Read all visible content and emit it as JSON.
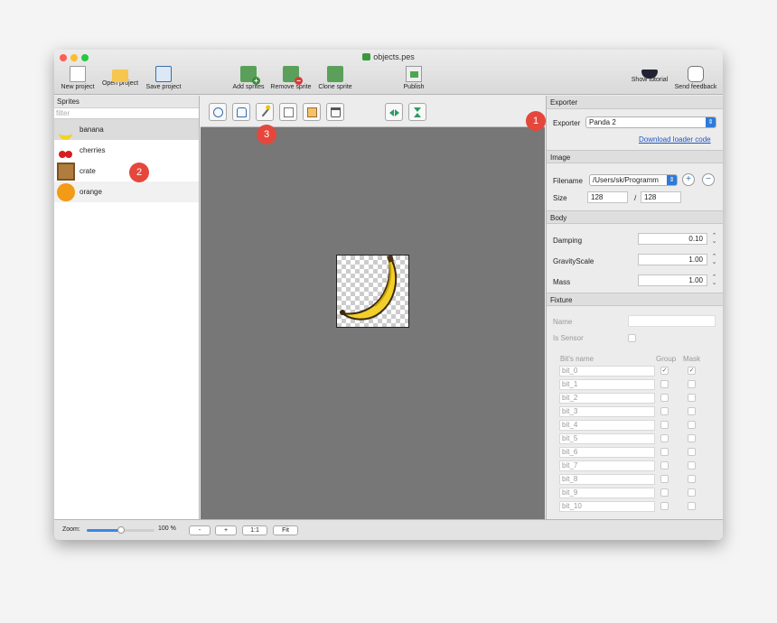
{
  "window": {
    "title": "objects.pes"
  },
  "toolbar": {
    "new_project": "New project",
    "open_project": "Open project",
    "save_project": "Save project",
    "add_sprites": "Add sprites",
    "remove_sprite": "Remove sprite",
    "clone_sprite": "Clone sprite",
    "publish": "Publish",
    "show_tutorial": "Show tutorial",
    "send_feedback": "Send feedback"
  },
  "sprites_panel": {
    "title": "Sprites",
    "filter_placeholder": "filter",
    "items": [
      {
        "name": "banana",
        "selected": true
      },
      {
        "name": "cherries",
        "selected": false
      },
      {
        "name": "crate",
        "selected": false
      },
      {
        "name": "orange",
        "selected": false
      }
    ]
  },
  "editor_tools": [
    "circle-tool",
    "polygon-tool",
    "magic-wand-tool",
    "copy-tool",
    "paste-tool",
    "delete-tool",
    "flip-horizontal-tool",
    "flip-vertical-tool"
  ],
  "exporter": {
    "section": "Exporter",
    "label": "Exporter",
    "value": "Panda 2",
    "download_link": "Download loader code"
  },
  "image": {
    "section": "Image",
    "filename_label": "Filename",
    "filename_value": "/Users/sk/Programm",
    "size_label": "Size",
    "width": "128",
    "separator": "/",
    "height": "128"
  },
  "body": {
    "section": "Body",
    "damping_label": "Damping",
    "damping_value": "0.10",
    "gravity_label": "GravityScale",
    "gravity_value": "1.00",
    "mass_label": "Mass",
    "mass_value": "1.00"
  },
  "fixture": {
    "section": "Fixture",
    "name_label": "Name",
    "sensor_label": "Is Sensor",
    "col_bits": "Bit's name",
    "col_group": "Group",
    "col_mask": "Mask",
    "bits": [
      {
        "name": "bit_0",
        "group": true,
        "mask": true
      },
      {
        "name": "bit_1",
        "group": false,
        "mask": false
      },
      {
        "name": "bit_2",
        "group": false,
        "mask": false
      },
      {
        "name": "bit_3",
        "group": false,
        "mask": false
      },
      {
        "name": "bit_4",
        "group": false,
        "mask": false
      },
      {
        "name": "bit_5",
        "group": false,
        "mask": false
      },
      {
        "name": "bit_6",
        "group": false,
        "mask": false
      },
      {
        "name": "bit_7",
        "group": false,
        "mask": false
      },
      {
        "name": "bit_8",
        "group": false,
        "mask": false
      },
      {
        "name": "bit_9",
        "group": false,
        "mask": false
      },
      {
        "name": "bit_10",
        "group": false,
        "mask": false
      }
    ]
  },
  "statusbar": {
    "zoom_label": "Zoom:",
    "zoom_value": "100 %",
    "zoom_level": 0.5,
    "minus": "-",
    "plus": "+",
    "one_to_one": "1:1",
    "fit": "Fit"
  },
  "callouts": [
    "1",
    "2",
    "3"
  ],
  "colors": {
    "accent": "#2f7ad8",
    "callout": "#e5473c",
    "canvas": "#777777"
  }
}
